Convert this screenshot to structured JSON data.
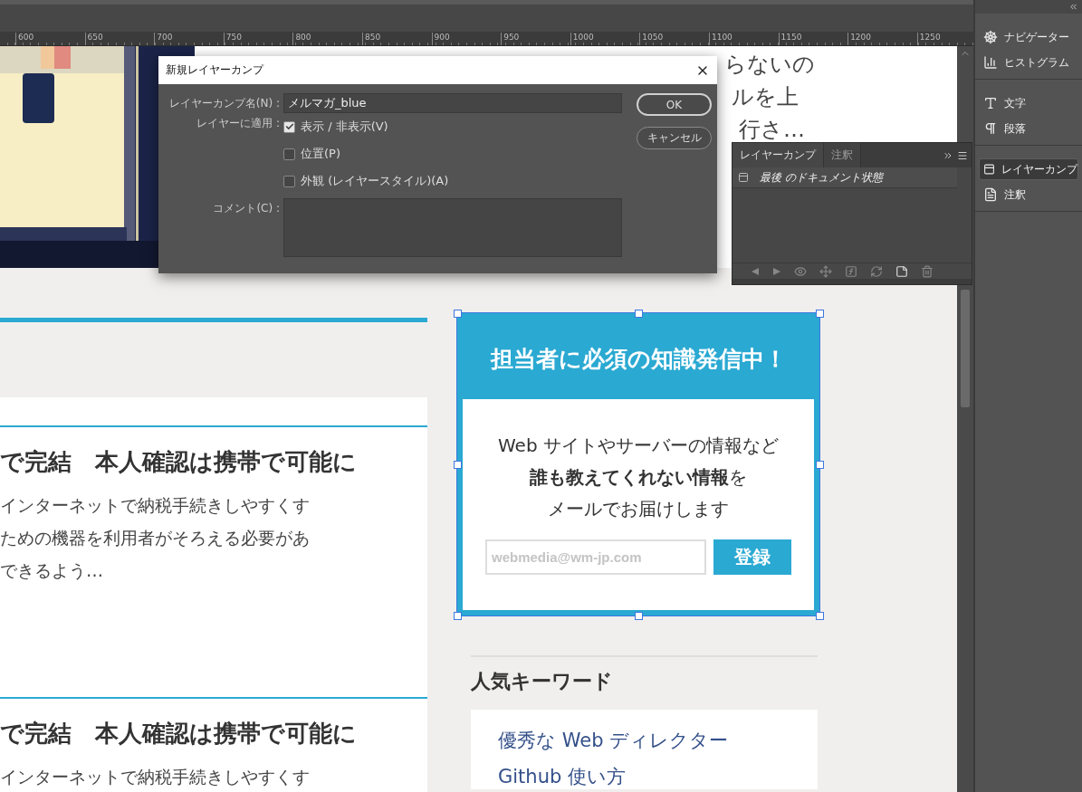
{
  "ruler": {
    "marks": [
      "600",
      "650",
      "700",
      "750",
      "800",
      "850",
      "900",
      "950",
      "1000",
      "1050",
      "1100",
      "1150",
      "1200",
      "1250"
    ]
  },
  "document": {
    "header_text": [
      "らないの",
      "ルを上",
      "行さ…"
    ],
    "articles": [
      {
        "title": "で完結　本人確認は携帯で可能に",
        "excerpt": [
          "インターネットで納税手続きしやすくす",
          "ための機器を利用者がそろえる必要があ",
          "できるよう…"
        ]
      },
      {
        "title": "で完結　本人確認は携帯で可能に",
        "excerpt": [
          "インターネットで納税手続きしやすくす"
        ]
      }
    ],
    "newsletter": {
      "heading": "担当者に必須の知識発信中！",
      "message": [
        "Web サイトやサーバーの情報など",
        "**誰も教えてくれない情報**を",
        "メールでお届けします"
      ],
      "email_placeholder": "webmedia@wm-jp.com",
      "button": "登録",
      "selected": true
    },
    "keywords": {
      "title": "人気キーワード",
      "items": [
        "優秀な Web ディレクター",
        "Github 使い方"
      ]
    }
  },
  "dialog": {
    "title": "新規レイヤーカンプ",
    "name_label": "レイヤーカンプ名(N) :",
    "name_value": "メルマガ_blue",
    "apply_label": "レイヤーに適用 :",
    "options": [
      {
        "label": "表示 / 非表示(V)",
        "checked": true
      },
      {
        "label": "位置(P)",
        "checked": false
      },
      {
        "label": "外観 (レイヤースタイル)(A)",
        "checked": false
      }
    ],
    "comment_label": "コメント(C) :",
    "buttons": [
      {
        "label": "OK",
        "default": true
      },
      {
        "label": "キャンセル",
        "default": false
      }
    ]
  },
  "layer_comps_panel": {
    "tabs": [
      {
        "label": "レイヤーカンプ",
        "selected": true
      },
      {
        "label": "注釈",
        "selected": false
      }
    ],
    "items": [
      {
        "label": "最後 のドキュメント状態"
      }
    ]
  },
  "dock": {
    "groups": [
      [
        {
          "kind": "navigator",
          "label": "ナビゲーター",
          "selected": false
        },
        {
          "kind": "histogram",
          "label": "ヒストグラム",
          "selected": false
        }
      ],
      [
        {
          "kind": "character",
          "label": "文字",
          "selected": false
        },
        {
          "kind": "paragraph",
          "label": "段落",
          "selected": false
        }
      ],
      [
        {
          "kind": "comps",
          "label": "レイヤーカンプ",
          "selected": true
        },
        {
          "kind": "notes",
          "label": "注釈",
          "selected": false
        }
      ]
    ]
  }
}
